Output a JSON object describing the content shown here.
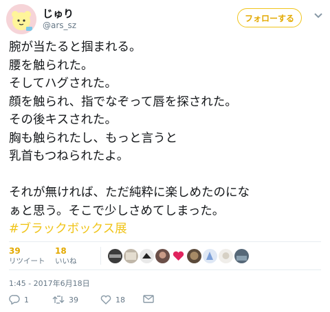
{
  "author": {
    "name": "じゅり",
    "handle": "@ars_sz",
    "avatar_icon": "cartoon-avatar"
  },
  "follow_label": "フォローする",
  "tweet_lines": [
    "腕が当たると掴まれる。",
    "腰を触られた。",
    "そしてハグされた。",
    "顔を触られ、指でなぞって唇を探された。",
    "その後キスされた。",
    "胸も触られたし、もっと言うと",
    "乳首もつねられたよ。",
    "",
    "それが無ければ、ただ純粋に楽しめたのにな",
    "ぁと思う。そこで少しさめてしまった。"
  ],
  "hashtag": "#ブラックボックス展",
  "stats": {
    "retweets_count": "39",
    "retweets_label": "リツイート",
    "likes_count": "18",
    "likes_label": "いいね"
  },
  "likers": [
    "liker-1",
    "liker-2",
    "liker-3",
    "liker-4",
    "heart",
    "liker-5",
    "liker-6",
    "liker-7",
    "liker-8"
  ],
  "timestamp": "1:45 - 2017年6月18日",
  "actions": {
    "reply_count": "1",
    "retweet_count": "39",
    "like_count": "18"
  },
  "colors": {
    "accent": "#f0c419",
    "muted": "#657786",
    "text": "#14171a"
  }
}
